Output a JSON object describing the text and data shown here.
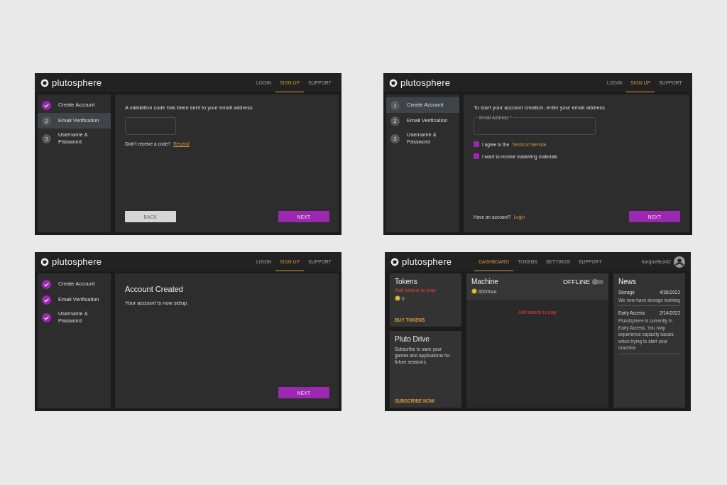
{
  "screens": [
    {
      "kind": "signup",
      "logo": "plutosphere",
      "nav": [
        {
          "label": "LOGIN",
          "selected": false
        },
        {
          "label": "SIGN UP",
          "selected": true
        },
        {
          "label": "SUPPORT",
          "selected": false
        }
      ],
      "steps": [
        {
          "label": "Create Account",
          "completed": true,
          "selected": false
        },
        {
          "label": "Email Verification",
          "number": "2",
          "completed": false,
          "selected": true
        },
        {
          "label": "Username & Password",
          "number": "3",
          "completed": false,
          "selected": false
        }
      ],
      "blocks": [
        {
          "kind": "text",
          "text": "A validation code has been sent to your email address"
        },
        {
          "kind": "field"
        },
        {
          "kind": "prompt",
          "text": "Didn't receive a code?",
          "link": "Resend"
        }
      ],
      "footer": [
        {
          "kind": "button",
          "label": "BACK",
          "primary": false
        },
        {
          "kind": "button",
          "label": "NEXT",
          "primary": true
        }
      ]
    },
    {
      "kind": "signup",
      "logo": "plutosphere",
      "nav": [
        {
          "label": "LOGIN",
          "selected": false
        },
        {
          "label": "SIGN UP",
          "selected": true
        },
        {
          "label": "SUPPORT",
          "selected": false
        }
      ],
      "steps": [
        {
          "label": "Create Account",
          "number": "1",
          "completed": false,
          "selected": true
        },
        {
          "label": "Email Verification",
          "number": "2",
          "completed": false,
          "selected": false
        },
        {
          "label": "Username & Password",
          "number": "3",
          "completed": false,
          "selected": false
        }
      ],
      "blocks": [
        {
          "kind": "text",
          "text": "To start your account creation, enter your email address"
        },
        {
          "kind": "field",
          "label": "Email Address *"
        },
        {
          "kind": "checkbox",
          "text": "I agree to the",
          "link": "Terms of Service",
          "checked": true
        },
        {
          "kind": "checkbox",
          "text": "I want to receive marketing materials",
          "checked": true
        }
      ],
      "footer": [
        {
          "kind": "prompt",
          "text": "Have an account?",
          "link": "Login"
        },
        {
          "kind": "button",
          "label": "NEXT",
          "primary": true
        }
      ]
    },
    {
      "kind": "signup",
      "logo": "plutosphere",
      "nav": [
        {
          "label": "LOGIN",
          "selected": false
        },
        {
          "label": "SIGN UP",
          "selected": true
        },
        {
          "label": "SUPPORT",
          "selected": false
        }
      ],
      "steps": [
        {
          "label": "Create Account",
          "completed": true,
          "selected": false
        },
        {
          "label": "Email Verification",
          "completed": true,
          "selected": false
        },
        {
          "label": "Username & Password",
          "completed": true,
          "selected": false
        }
      ],
      "blocks": [
        {
          "kind": "heading",
          "text": "Account Created"
        },
        {
          "kind": "text",
          "text": "Your account is now setup."
        }
      ],
      "footer": [
        {
          "kind": "button",
          "label": "NEXT",
          "primary": true
        }
      ]
    },
    {
      "kind": "dashboard",
      "logo": "plutosphere",
      "nav": [
        {
          "label": "DASHBOARD",
          "selected": true
        },
        {
          "label": "TOKENS",
          "selected": false
        },
        {
          "label": "SETTINGS",
          "selected": false
        },
        {
          "label": "SUPPORT",
          "selected": false
        }
      ],
      "user": {
        "name": "fordprefect42"
      },
      "tokens": {
        "title": "Tokens",
        "warning": "Add tokens to play",
        "balance": "0",
        "action": "BUY TOKENS"
      },
      "drive": {
        "title": "Pluto Drive",
        "text": "Subscribe to save your games and applications for future sessions.",
        "action": "SUBSCRIBE NOW"
      },
      "machine": {
        "title": "Machine",
        "status": "OFFLINE",
        "on": false,
        "rate": "600/hour",
        "message": "Add tokens to play"
      },
      "news": {
        "title": "News",
        "items": [
          {
            "title": "Storage",
            "date": "4/26/2022",
            "text": "We now have storage working"
          },
          {
            "title": "Early Access",
            "date": "2/14/2022",
            "text": "PlutoSphere is currently in Early Access. You may experience capacity issues when trying to start your machine"
          }
        ]
      }
    }
  ]
}
